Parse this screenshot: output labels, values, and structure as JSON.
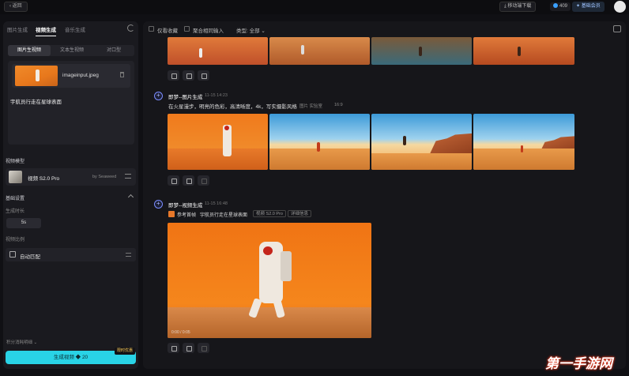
{
  "topbar": {
    "back": "返回",
    "download": "移动端下载",
    "points": "409",
    "vip": "基础会员"
  },
  "left": {
    "mode_tabs": [
      "图片生成",
      "视频生成",
      "音乐生成"
    ],
    "sub_tabs": [
      "图片生视频",
      "文本生视频",
      "对口型"
    ],
    "upload_filename": "imageinput.jpeg",
    "prompt": "宇航员行走在星球表面",
    "model_section": "视频模型",
    "model_name": "视频 S2.0 Pro",
    "model_by": "by Seaweed",
    "basic_section": "基础设置",
    "duration_label": "生成时长",
    "duration_value": "5s",
    "ratio_label": "视频比例",
    "ratio_value": "自动匹配",
    "credits": "积分消耗明细",
    "generate": "生成视频",
    "generate_cost": "20",
    "promo": "限时优惠"
  },
  "filters": {
    "only_fav": "仅看收藏",
    "aggregate": "聚合相同输入",
    "type": "类型: 全部"
  },
  "task1": {
    "title": "即梦--图片生成",
    "time": "11-15 14:23",
    "desc": "在火星漫步，明亮的色彩，高清晰度，4k，写实摄影风格",
    "tag_model": "图片 实验室",
    "tag_ratio": "16:9"
  },
  "task2": {
    "title": "即梦--视频生成",
    "time": "11-15 16:48",
    "ref_label": "参考首帧",
    "prompt": "宇航员行走在星球表面",
    "chip_model": "视频 S2.0 Pro",
    "chip_detail": "详细信息",
    "video_time": "0:00 / 0:05"
  },
  "watermark": "第一手游网"
}
